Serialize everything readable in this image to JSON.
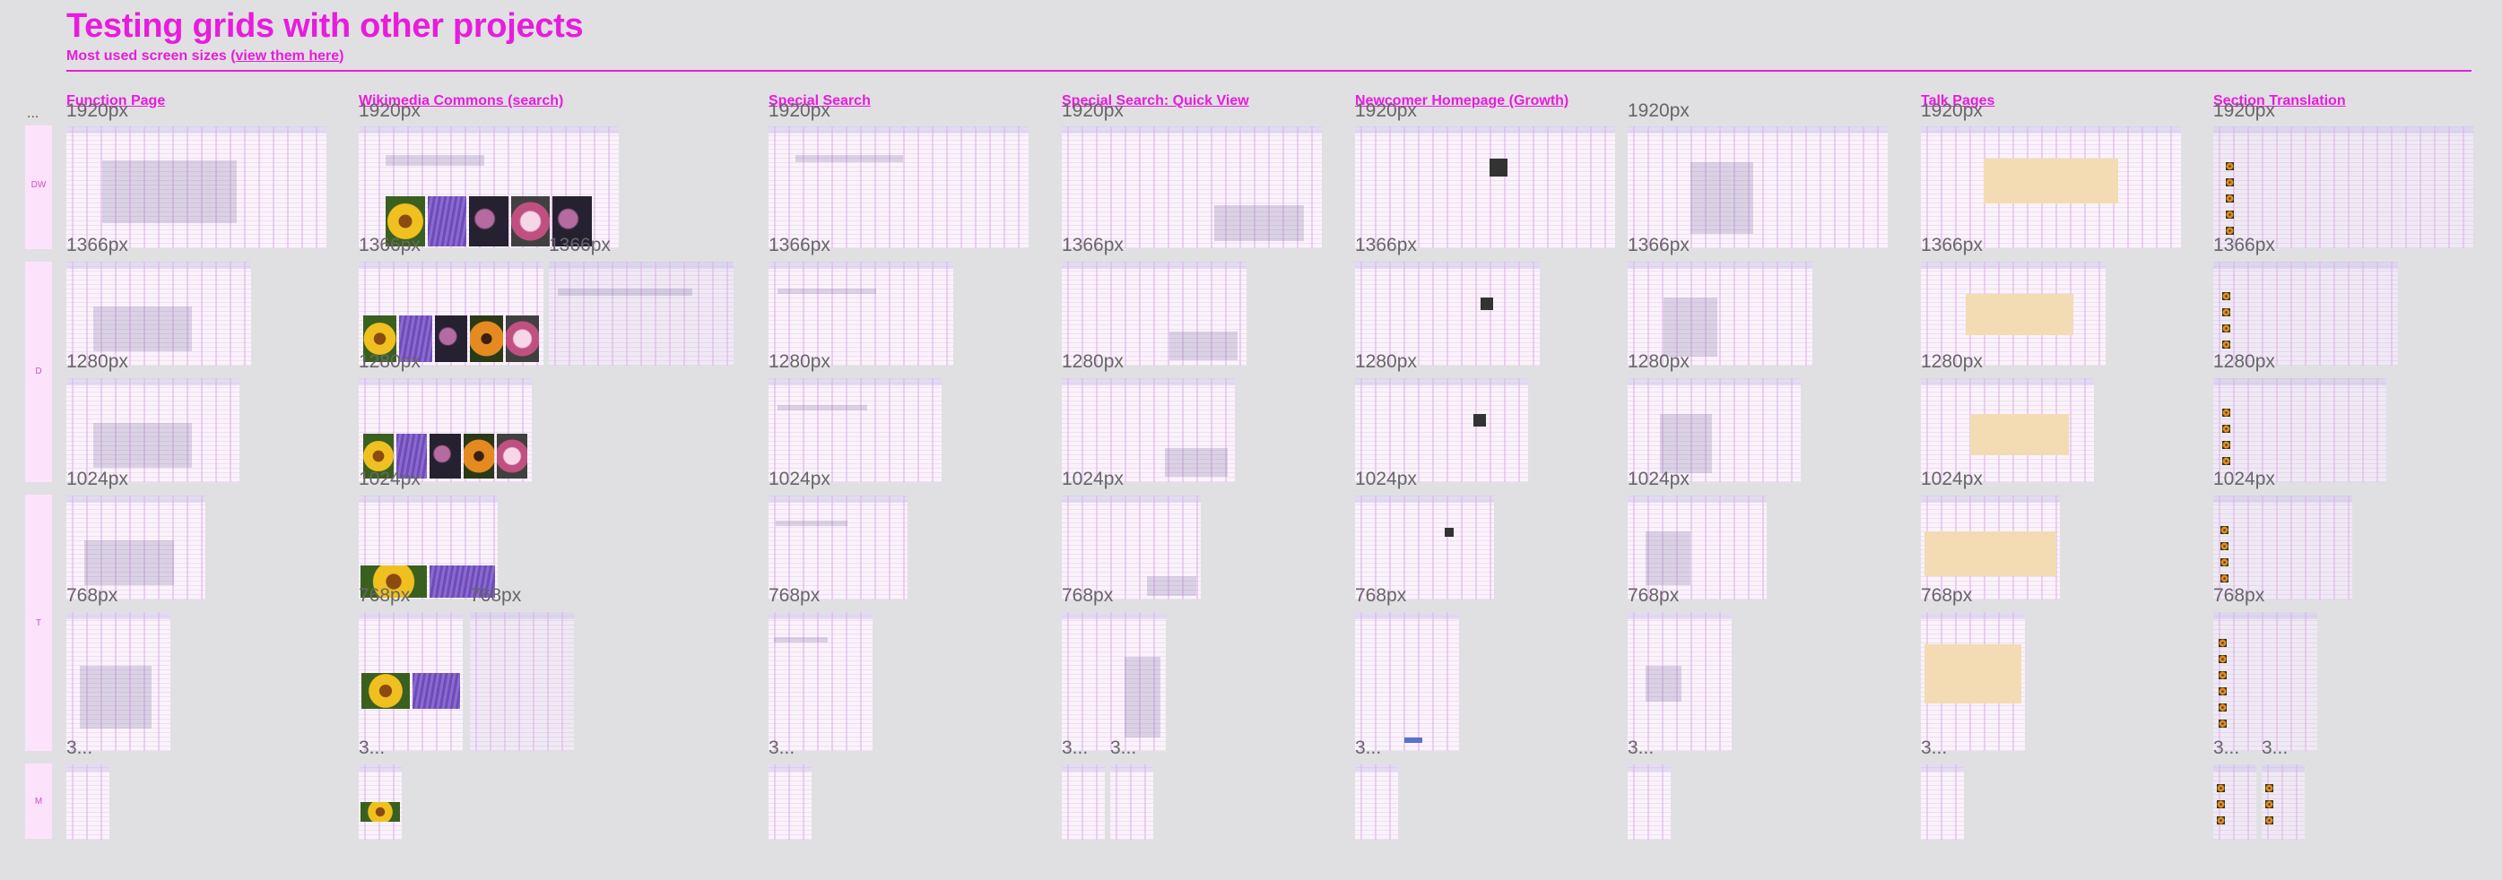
{
  "page": {
    "title": "Testing grids with other projects",
    "subtitle_prefix": "Most used screen sizes (",
    "subtitle_link": "view them here",
    "subtitle_suffix": ")",
    "ellipsis": "..."
  },
  "columns": [
    {
      "title": "Function Page"
    },
    {
      "title": "Wikimedia Commons (search)"
    },
    {
      "title": "Special Search"
    },
    {
      "title": "Special Search: Quick View"
    },
    {
      "title": "Newcomer Homepage (Growth)"
    },
    {
      "title": ""
    },
    {
      "title": "Talk Pages"
    },
    {
      "title": "Section Translation"
    }
  ],
  "rows": [
    {
      "label": "DW"
    },
    {
      "label": "D"
    },
    {
      "label": "T"
    },
    {
      "label": "M"
    }
  ],
  "sizes": {
    "s1920": "1920px",
    "s1366": "1366px",
    "s1280": "1280px",
    "s1024": "1024px",
    "s768": "768px",
    "s3": "3..."
  },
  "colors": {
    "accent": "#e81cdc",
    "background": "#e0e0e3",
    "row_band": "#fce3fb",
    "talk_banner": "#f3dcb4"
  }
}
